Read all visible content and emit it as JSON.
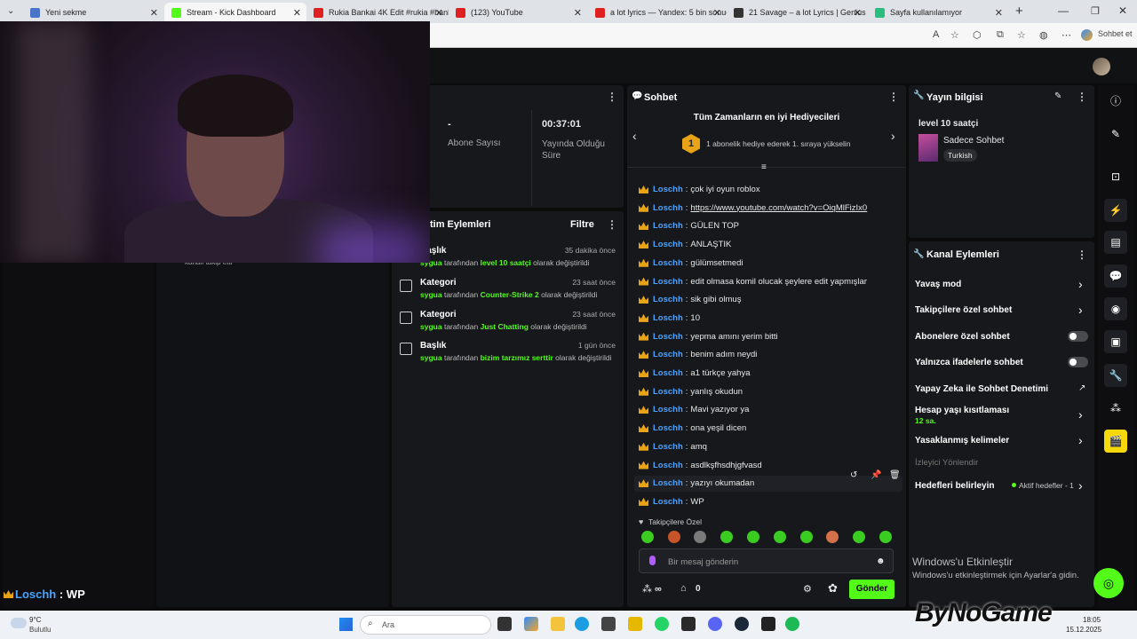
{
  "browser": {
    "tabs": [
      {
        "label": "Yeni sekme",
        "color": "#4b74c9"
      },
      {
        "label": "Stream - Kick Dashboard",
        "color": "#53fc18"
      },
      {
        "label": "Rukia Bankai 4K Edit #rukia #bank",
        "color": "#e02020"
      },
      {
        "label": "(123) YouTube",
        "color": "#e02020"
      },
      {
        "label": "a lot lyrics — Yandex: 5 bin sonuç",
        "color": "#e02020"
      },
      {
        "label": "21 Savage – a lot Lyrics | Genius Ly",
        "color": "#333333"
      },
      {
        "label": "Sayfa kullanılamıyor",
        "color": "#2bbd7e"
      }
    ],
    "sohbet_et": "Sohbet et"
  },
  "stats": {
    "subs_value": "-",
    "subs_label": "Abone Sayısı",
    "live_value": "00:37:01",
    "live_label": "Yayında Olduğu Süre"
  },
  "left_overlay_text": "kanalı takip etti",
  "overlay_chat": {
    "user": "Loschh",
    "sep": " : ",
    "msg": "WP"
  },
  "actions": {
    "title": "tim Eylemleri",
    "filter": "Filtre",
    "items": [
      {
        "title": "Başlık",
        "time": "35 dakika önce",
        "by": "sygua",
        "mid": "tarafından",
        "value": "level 10 saatçi",
        "end": "olarak değiştirildi"
      },
      {
        "title": "Kategori",
        "time": "23 saat önce",
        "by": "sygua",
        "mid": "tarafından",
        "value": "Counter-Strike 2",
        "end": "olarak değiştirildi"
      },
      {
        "title": "Kategori",
        "time": "23 saat önce",
        "by": "sygua",
        "mid": "tarafından",
        "value": "Just Chatting",
        "end": "olarak değiştirildi"
      },
      {
        "title": "Başlık",
        "time": "1 gün önce",
        "by": "sygua",
        "mid": "tarafından",
        "value": "bizim tarzımız serttir",
        "end": "olarak değiştirildi"
      }
    ]
  },
  "chat": {
    "title": "Sohbet",
    "gifters_title": "Tüm Zamanların en iyi Hediyecileri",
    "gifters_rank": "1",
    "gifters_text": "1 abonelik hediye ederek 1. sıraya yükselin",
    "messages": [
      {
        "user": "Loschh",
        "text": "çok iyi oyun roblox"
      },
      {
        "user": "Loschh",
        "text": "https://www.youtube.com/watch?v=OiqMlFizIx0",
        "link": true
      },
      {
        "user": "Loschh",
        "text": "GÜLEN TOP"
      },
      {
        "user": "Loschh",
        "text": "ANLAŞTIK"
      },
      {
        "user": "Loschh",
        "text": "gülümsetmedi"
      },
      {
        "user": "Loschh",
        "text": "edit olmasa komil olucak şeylere edit yapmışlar"
      },
      {
        "user": "Loschh",
        "text": "sik gibi olmuş"
      },
      {
        "user": "Loschh",
        "text": "10"
      },
      {
        "user": "Loschh",
        "text": "yepma amını yerim bitti"
      },
      {
        "user": "Loschh",
        "text": "benim adım neydi"
      },
      {
        "user": "Loschh",
        "text": "a1 türkçe yahya"
      },
      {
        "user": "Loschh",
        "text": "yanlış okudun"
      },
      {
        "user": "Loschh",
        "text": "Mavi yazıyor ya"
      },
      {
        "user": "Loschh",
        "text": "ona yeşil dicen"
      },
      {
        "user": "Loschh",
        "text": "amq"
      },
      {
        "user": "Loschh",
        "text": "asdlkşfhsdhjgfvasd"
      },
      {
        "user": "Loschh",
        "text": "yazıyı okumadan"
      },
      {
        "user": "Loschh",
        "text": "WP"
      }
    ],
    "followers_only": "Takipçilere Özel",
    "input_placeholder": "Bir mesaj gönderin",
    "points": "∞",
    "count": "0",
    "send": "Gönder"
  },
  "stream_info": {
    "title": "Yayın bilgisi",
    "stream_title": "level 10 saatçi",
    "category": "Sadece Sohbet",
    "language": "Turkish"
  },
  "channel_actions": {
    "title": "Kanal Eylemleri",
    "slow": "Yavaş mod",
    "followers": "Takipçilere özel sohbet",
    "subs": "Abonelere özel sohbet",
    "emotes": "Yalnızca ifadelerle sohbet",
    "ai": "Yapay Zeka ile Sohbet Denetimi",
    "age": "Hesap yaşı kısıtlaması",
    "age_value": "12 sa.",
    "banned": "Yasaklanmış kelimeler",
    "viewer": "İzleyici Yönlendir",
    "goals": "Hedefleri belirleyin",
    "goals_status": "Aktif hedefler - 1"
  },
  "windows": {
    "activate_title": "Windows'u Etkinleştir",
    "activate_sub": "Windows'u etkinleştirmek için Ayarlar'a gidin.",
    "temp": "9°C",
    "weather": "Bulutlu",
    "search": "Ara",
    "time": "18:05",
    "date": "15.12.2025"
  },
  "watermark": "ByNoGame",
  "colors": {
    "accent": "#53fc18",
    "username": "#4aa3ff",
    "crown": "#e8a317"
  }
}
